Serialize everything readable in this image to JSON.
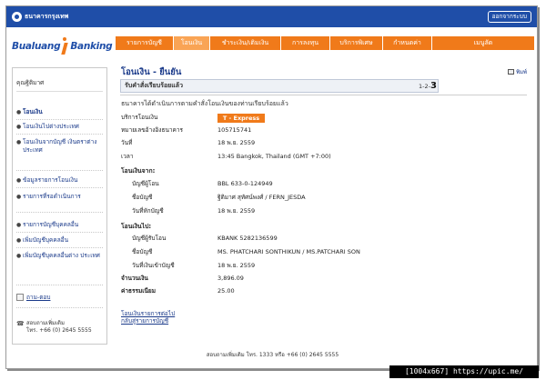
{
  "topbar": {
    "bank_name": "ธนาคารกรุงเทพ",
    "logout": "ออกจากระบบ"
  },
  "brand": {
    "left": "Bualuang",
    "right": "Banking"
  },
  "nav": {
    "tabs": [
      {
        "label": "รายการบัญชี",
        "active": false
      },
      {
        "label": "โอนเงิน",
        "active": true
      },
      {
        "label": "ชำระเงิน/เติมเงิน",
        "active": false
      },
      {
        "label": "การลงทุน",
        "active": false
      },
      {
        "label": "บริการพิเศษ",
        "active": false
      },
      {
        "label": "กำหนดค่า",
        "active": false
      },
      {
        "label": "เมนูลัด",
        "active": false
      }
    ]
  },
  "sidebar": {
    "user": "คุณฐิติมาศ",
    "items": [
      {
        "label": "โอนเงิน",
        "active": true
      },
      {
        "label": "โอนเงินไปต่างประเทศ",
        "active": false
      },
      {
        "label": "โอนเงินจากบัญชี เงินตราต่างประเทศ",
        "active": false
      },
      {
        "label": "ข้อมูลรายการโอนเงิน",
        "active": false
      },
      {
        "label": "รายการที่รอดำเนินการ",
        "active": false
      },
      {
        "label": "รายการบัญชีบุคคลอื่น",
        "active": false
      },
      {
        "label": "เพิ่มบัญชีบุคคลอื่น",
        "active": false
      },
      {
        "label": "เพิ่มบัญชีบุคคลอื่นต่าง ประเทศ",
        "active": false
      }
    ],
    "help": "ถาม-ตอบ",
    "contact_line1": "สอบถามเพิ่มเติม",
    "contact_line2": "โทร. +66 (0) 2645 5555"
  },
  "main": {
    "title": "โอนเงิน - ยืนยัน",
    "print": "พิมพ์",
    "status": "รับคำสั่งเรียบร้อยแล้ว",
    "steps_prefix": "1-2-",
    "steps_current": "3",
    "success": "ธนาคารได้ดำเนินการตามคำสั่งโอนเงินของท่านเรียบร้อยแล้ว",
    "service_label": "บริการโอนเงิน",
    "service_value": "T - Express",
    "ref_label": "หมายเลขอ้างอิงธนาคาร",
    "ref_value": "105715741",
    "date_label": "วันที่",
    "date_value": "18 พ.ย. 2559",
    "time_label": "เวลา",
    "time_value": "13:45 Bangkok, Thailand (GMT +7:00)",
    "from_section": "โอนเงินจาก:",
    "from_account_label": "บัญชีผู้โอน",
    "from_account_value": "BBL 633-0-124949",
    "from_name_label": "ชื่อบัญชี",
    "from_name_value": "ฐิติมาศ สุทัศน์พงศ์ / FERN_JESDA",
    "from_date_label": "วันที่หักบัญชี",
    "from_date_value": "18 พ.ย. 2559",
    "to_section": "โอนเงินไป:",
    "to_account_label": "บัญชีผู้รับโอน",
    "to_account_value": "KBANK 5282136599",
    "to_name_label": "ชื่อบัญชี",
    "to_name_value": "MS. PHATCHARI SONTHIKUN / MS.PATCHARI SON",
    "to_date_label": "วันที่เงินเข้าบัญชี",
    "to_date_value": "18 พ.ย. 2559",
    "amount_label": "จำนวนเงิน",
    "amount_value": "3,896.09",
    "fee_label": "ค่าธรรมเนียม",
    "fee_value": "25.00",
    "link1": "โอนเงินรายการต่อไป",
    "link2": "กลับสู่รายการบัญชี"
  },
  "footer": "สอบถามเพิ่มเติม โทร. 1333 หรือ +66 (0) 2645 5555",
  "watermark": "[1004x667] https://upic.me/"
}
